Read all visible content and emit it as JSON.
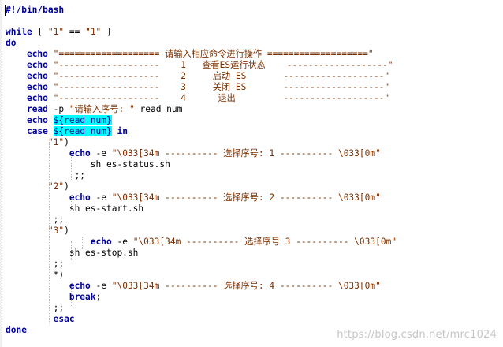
{
  "editor": {
    "lines": [
      {
        "segments": [
          {
            "t": "#!/bin/bash",
            "c": "kw"
          }
        ]
      },
      {
        "segments": []
      },
      {
        "segments": [
          {
            "t": "while",
            "c": "kw"
          },
          {
            "t": " [ ",
            "c": "op"
          },
          {
            "t": "\"1\"",
            "c": "str"
          },
          {
            "t": " == ",
            "c": "op"
          },
          {
            "t": "\"1\"",
            "c": "str"
          },
          {
            "t": " ]",
            "c": "op"
          }
        ]
      },
      {
        "segments": [
          {
            "t": "do",
            "c": "kw"
          }
        ]
      },
      {
        "segments": [
          {
            "t": "    "
          },
          {
            "t": "echo",
            "c": "bi"
          },
          {
            "t": " "
          },
          {
            "t": "\"=================== 请输入相应命令进行操作 ===================\"",
            "c": "str"
          }
        ]
      },
      {
        "segments": [
          {
            "t": "    "
          },
          {
            "t": "echo",
            "c": "bi"
          },
          {
            "t": " "
          },
          {
            "t": "\"-------------------    1   查看ES运行状态    -------------------\"",
            "c": "str"
          }
        ]
      },
      {
        "segments": [
          {
            "t": "    "
          },
          {
            "t": "echo",
            "c": "bi"
          },
          {
            "t": " "
          },
          {
            "t": "\"-------------------    2     启动 ES       -------------------\"",
            "c": "str"
          }
        ]
      },
      {
        "segments": [
          {
            "t": "    "
          },
          {
            "t": "echo",
            "c": "bi"
          },
          {
            "t": " "
          },
          {
            "t": "\"-------------------    3     关闭 ES       -------------------\"",
            "c": "str"
          }
        ]
      },
      {
        "segments": [
          {
            "t": "    "
          },
          {
            "t": "echo",
            "c": "bi"
          },
          {
            "t": " "
          },
          {
            "t": "\"-------------------    4      退出         -------------------\"",
            "c": "str"
          }
        ]
      },
      {
        "segments": [
          {
            "t": "    "
          },
          {
            "t": "read",
            "c": "bi"
          },
          {
            "t": " -p "
          },
          {
            "t": "\"请输入序号: \"",
            "c": "str"
          },
          {
            "t": " read_num"
          }
        ]
      },
      {
        "segments": [
          {
            "t": "    "
          },
          {
            "t": "echo",
            "c": "bi"
          },
          {
            "t": " "
          },
          {
            "t": "${read_num}",
            "c": "var"
          }
        ]
      },
      {
        "segments": [
          {
            "t": "    "
          },
          {
            "t": "case",
            "c": "kw"
          },
          {
            "t": " "
          },
          {
            "t": "${read_num}",
            "c": "var"
          },
          {
            "t": " "
          },
          {
            "t": "in",
            "c": "kw"
          }
        ]
      },
      {
        "segments": [
          {
            "t": "        "
          },
          {
            "t": "\"1\"",
            "c": "str"
          },
          {
            "t": ")"
          }
        ]
      },
      {
        "segments": [
          {
            "t": "            "
          },
          {
            "t": "echo",
            "c": "bi"
          },
          {
            "t": " -e "
          },
          {
            "t": "\"\\033[34m ---------- 选择序号: 1 ---------- \\033[0m\"",
            "c": "str"
          }
        ]
      },
      {
        "segments": [
          {
            "t": "                "
          },
          {
            "t": "sh es-status.sh"
          }
        ]
      },
      {
        "segments": [
          {
            "t": "             "
          },
          {
            "t": ";;"
          }
        ]
      },
      {
        "segments": [
          {
            "t": "        "
          },
          {
            "t": "\"2\"",
            "c": "str"
          },
          {
            "t": ")"
          }
        ]
      },
      {
        "segments": [
          {
            "t": "            "
          },
          {
            "t": "echo",
            "c": "bi"
          },
          {
            "t": " -e "
          },
          {
            "t": "\"\\033[34m ---------- 选择序号: 2 ---------- \\033[0m\"",
            "c": "str"
          }
        ]
      },
      {
        "segments": [
          {
            "t": "            "
          },
          {
            "t": "sh es-start.sh"
          }
        ]
      },
      {
        "segments": [
          {
            "t": "         "
          },
          {
            "t": ";;"
          }
        ]
      },
      {
        "segments": [
          {
            "t": "        "
          },
          {
            "t": "\"3\"",
            "c": "str"
          },
          {
            "t": ")"
          }
        ]
      },
      {
        "segments": [
          {
            "t": "                "
          },
          {
            "t": "echo",
            "c": "bi"
          },
          {
            "t": " -e "
          },
          {
            "t": "\"\\033[34m ---------- 选择序号 3 ---------- \\033[0m\"",
            "c": "str"
          }
        ]
      },
      {
        "segments": [
          {
            "t": "            "
          },
          {
            "t": "sh es-stop.sh"
          }
        ]
      },
      {
        "segments": [
          {
            "t": "         "
          },
          {
            "t": ";;"
          }
        ]
      },
      {
        "segments": [
          {
            "t": "         "
          },
          {
            "t": "*)"
          }
        ]
      },
      {
        "segments": [
          {
            "t": "            "
          },
          {
            "t": "echo",
            "c": "bi"
          },
          {
            "t": " -e "
          },
          {
            "t": "\"\\033[34m ---------- 选择序号: 4 ---------- \\033[0m\"",
            "c": "str"
          }
        ]
      },
      {
        "segments": [
          {
            "t": "            "
          },
          {
            "t": "break",
            "c": "kw"
          },
          {
            "t": ";"
          }
        ]
      },
      {
        "segments": [
          {
            "t": "         "
          },
          {
            "t": ";;"
          }
        ]
      },
      {
        "segments": [
          {
            "t": "         "
          },
          {
            "t": "esac",
            "c": "kw"
          }
        ]
      },
      {
        "segments": [
          {
            "t": "done",
            "c": "kw"
          }
        ]
      }
    ]
  },
  "watermark": "https://blog.csdn.net/mrc1024"
}
